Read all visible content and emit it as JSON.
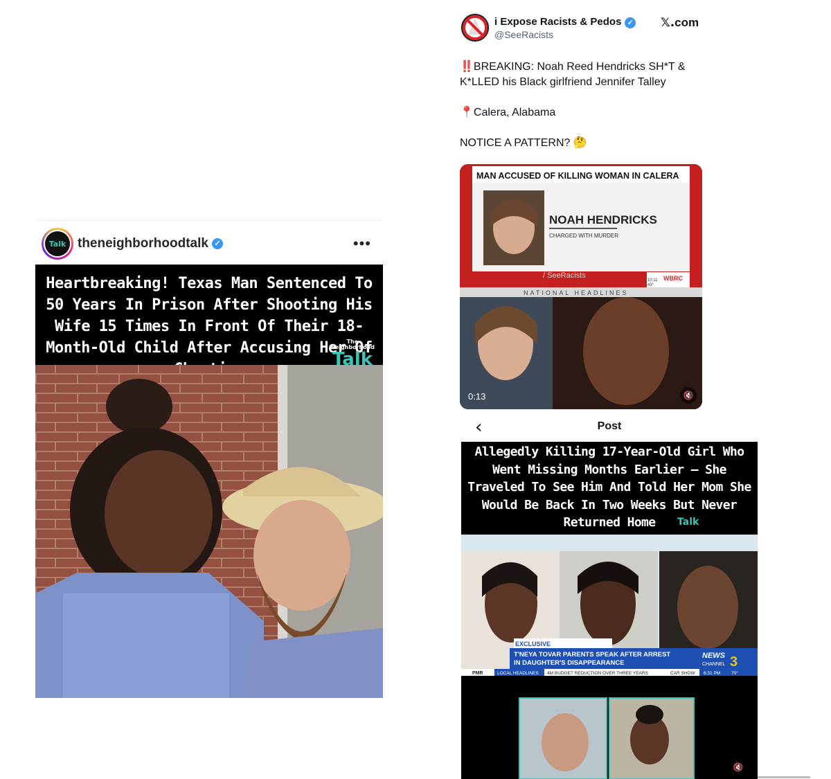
{
  "instagram": {
    "username": "theneighborhoodtalk",
    "avatar_text": "Talk",
    "more_icon": "•••",
    "headline": "Heartbreaking! Texas Man Sentenced To 50 Years In Prison After Shooting His Wife 15 Times In Front Of Their 18-Month-Old Child After Accusing Her Of Cheating",
    "watermark_small": "The Neighborhood",
    "watermark": "Talk"
  },
  "x_post": {
    "display_name": "i Expose Racists & Pedos",
    "handle": "@SeeRacists",
    "brand": "com",
    "brand_logo": "𝕏.",
    "breaking_icon": "‼️",
    "line1": "BREAKING: Noah Reed Hendricks SH*T & K*LLED his Black girlfriend Jennifer Talley",
    "location_icon": "📍",
    "location": "Calera, Alabama",
    "line3": "NOTICE A PATTERN? 🤔",
    "video": {
      "lower_third": "MAN ACCUSED OF KILLING WOMAN IN CALERA",
      "name": "NOAH HENDRICKS",
      "charge": "CHARGED WITH MURDER",
      "watermark": "/ SeeRacists",
      "station": "WBRC",
      "clock": "10:11",
      "temp": "43°",
      "ticker": "NATIONAL  HEADLINES",
      "time": "0:13"
    }
  },
  "post_screen": {
    "back_icon": "‹",
    "title": "Post",
    "headline": "Allegedly Killing 17-Year-Old Girl Who Went Missing Months Earlier — She Traveled To See Him And Told Her Mom She Would Be Back In Two Weeks But Never Returned Home",
    "watermark": "Talk",
    "news": {
      "tag": "EXCLUSIVE",
      "line1": "T'NEYA TOVAR PARENTS SPEAK AFTER ARREST",
      "line2": "IN DAUGHTER'S DISAPPEARANCE",
      "station": "NEWS",
      "channel": "CHANNEL",
      "channel_num": "3",
      "left_tag": "PMR",
      "local": "LOCAL HEADLINES",
      "ticker": "4M BUDGET REDUCTION OVER THREE YEARS",
      "ticker2": "CAR SHOW",
      "time": "6:31 PM",
      "temp": "70°"
    }
  },
  "colors": {
    "verified": "#3897f0",
    "talk_teal": "#3fc3b3",
    "wbrc_red": "#d8242b",
    "news_blue": "#1e4fb3"
  }
}
